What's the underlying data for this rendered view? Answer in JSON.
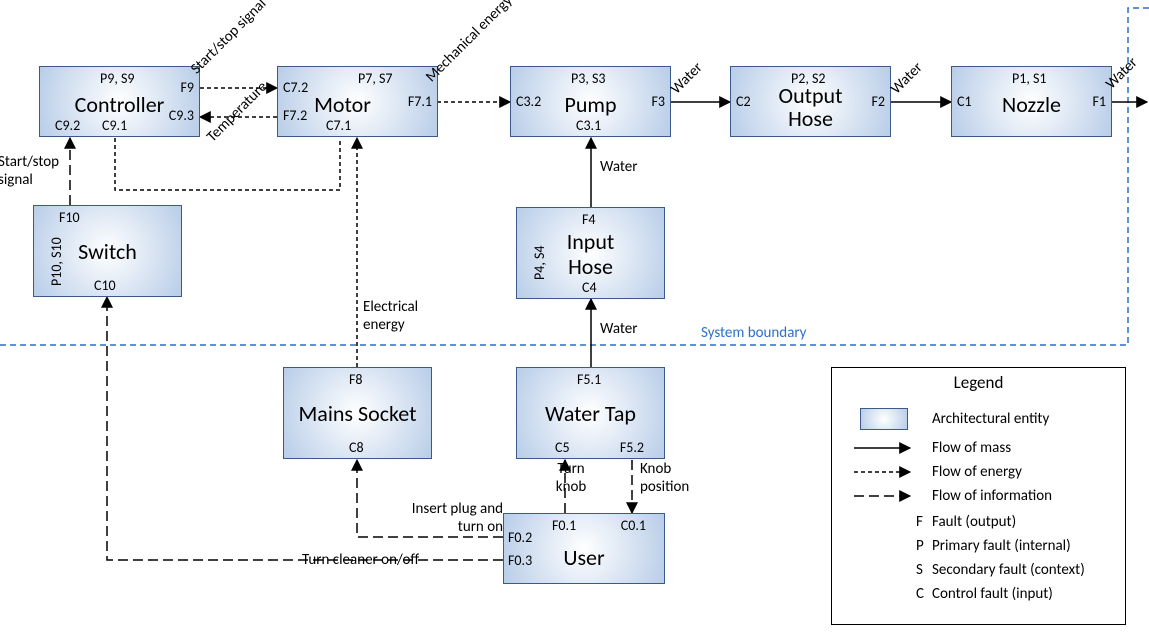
{
  "entities": {
    "controller": {
      "title": "Controller",
      "ps": "P9, S9",
      "ports": {
        "f9": "F9",
        "c92": "C9.2",
        "c91": "C9.1",
        "c93": "C9.3"
      }
    },
    "motor": {
      "title": "Motor",
      "ps": "P7, S7",
      "ports": {
        "c72": "C7.2",
        "f71": "F7.1",
        "f72": "F7.2",
        "c71": "C7.1"
      }
    },
    "pump": {
      "title": "Pump",
      "ps": "P3, S3",
      "ports": {
        "c32": "C3.2",
        "f3": "F3",
        "c31": "C3.1"
      }
    },
    "outputhose": {
      "title": "Output",
      "title2": "Hose",
      "ps": "P2, S2",
      "ports": {
        "c2": "C2",
        "f2": "F2"
      }
    },
    "nozzle": {
      "title": "Nozzle",
      "ps": "P1, S1",
      "ports": {
        "c1": "C1",
        "f1": "F1"
      }
    },
    "switch": {
      "title": "Switch",
      "ps": "P10, S10",
      "ports": {
        "f10": "F10",
        "c10": "C10"
      }
    },
    "inputhose": {
      "title": "Input",
      "title2": "Hose",
      "ps": "P4, S4",
      "ports": {
        "f4": "F4",
        "c4": "C4"
      }
    },
    "mainssocket": {
      "title": "Mains Socket",
      "ports": {
        "f8": "F8",
        "c8": "C8"
      }
    },
    "watertap": {
      "title": "Water Tap",
      "ports": {
        "f51": "F5.1",
        "c5": "C5",
        "f52": "F5.2"
      }
    },
    "user": {
      "title": "User",
      "ports": {
        "f01": "F0.1",
        "c01": "C0.1",
        "f02": "F0.2",
        "f03": "F0.3"
      }
    }
  },
  "flows": {
    "startstop_ctrl_motor": "Start/stop signal",
    "temperature": "Temperature",
    "mechanical": "Mechanical energy",
    "water": "Water",
    "startstop_switch": "Start/stop signal",
    "electrical": "Electrical energy",
    "turnknob": "Turn knob",
    "knobpos": "Knob position",
    "insertplug1": "Insert plug",
    "insertplug2": "and turn on",
    "turncleaner": "Turn cleaner on/off",
    "sysboundary": "System boundary"
  },
  "legend": {
    "title": "Legend",
    "entity": "Architectural entity",
    "mass": "Flow of mass",
    "energy": "Flow of energy",
    "info": "Flow of information",
    "F": "F",
    "F_desc": "Fault (output)",
    "P": "P",
    "P_desc": "Primary fault (internal)",
    "S": "S",
    "S_desc": "Secondary fault (context)",
    "C": "C",
    "C_desc": "Control fault (input)"
  }
}
